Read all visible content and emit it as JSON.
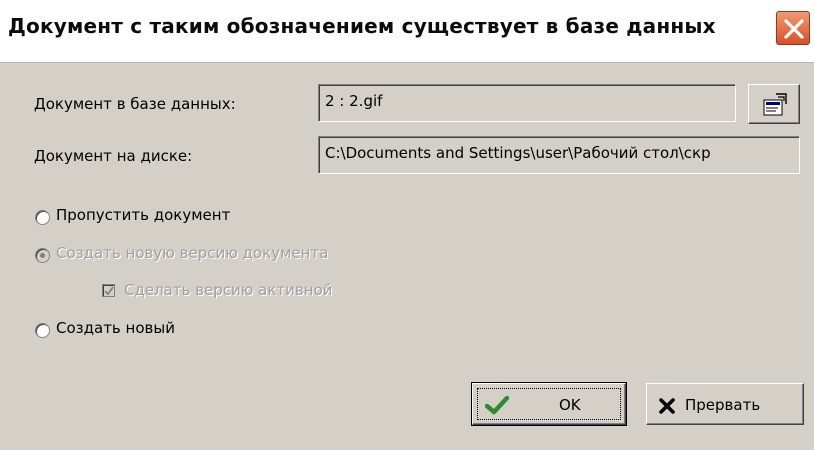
{
  "dialog": {
    "title": "Документ с таким обозначением существует в базе данных",
    "close_icon": "close-icon"
  },
  "fields": {
    "db_doc_label": "Документ в базе данных:",
    "db_doc_value": "2 : 2.gif",
    "disk_doc_label": "Документ на диске:",
    "disk_doc_value": "C:\\Documents and Settings\\user\\Рабочий стол\\скр",
    "properties_icon": "properties-icon"
  },
  "options": {
    "skip": "Пропустить документ",
    "new_version": "Создать новую версию документа",
    "make_active": "Сделать версию активной",
    "create_new": "Создать новый",
    "selected": "new_version",
    "make_active_checked": true
  },
  "buttons": {
    "ok": "OK",
    "ok_icon": "checkmark-icon",
    "abort": "Прервать",
    "abort_icon": "x-cross-icon"
  },
  "colors": {
    "close_button": "#d8502a",
    "ok_check": "#2e8b2e",
    "abort_cross": "#000000"
  }
}
